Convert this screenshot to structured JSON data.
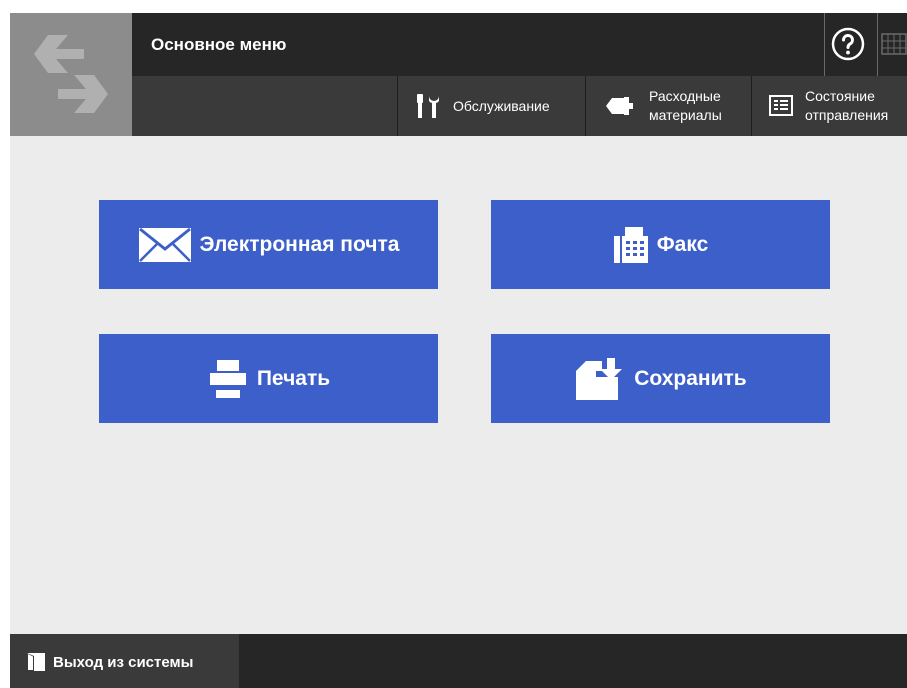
{
  "header": {
    "title": "Основное меню",
    "help_icon": "question-circle-icon",
    "keyboard_icon": "keyboard-icon",
    "logo_icon": "swap-arrows-icon",
    "toolbar": [
      {
        "icon": "wrench-screwdriver-icon",
        "lines": [
          "Обслуживание"
        ]
      },
      {
        "icon": "toner-cartridge-icon",
        "lines": [
          "Расходные",
          "материалы"
        ]
      },
      {
        "icon": "list-icon",
        "lines": [
          "Состояние",
          "отправления"
        ]
      }
    ]
  },
  "main": {
    "buttons": [
      {
        "label": "Электронная почта",
        "icon": "envelope-icon"
      },
      {
        "label": "Факс",
        "icon": "fax-icon"
      },
      {
        "label": "Печать",
        "icon": "printer-icon"
      },
      {
        "label": "Сохранить",
        "icon": "folder-save-icon"
      }
    ]
  },
  "footer": {
    "logout_label": "Выход из системы",
    "logout_icon": "logout-door-icon"
  },
  "colors": {
    "accent": "#3d5fc9",
    "header_dark": "#262626",
    "header_mid": "#3a3a3a",
    "logo_bg": "#8c8c8c",
    "background": "#ececec"
  }
}
